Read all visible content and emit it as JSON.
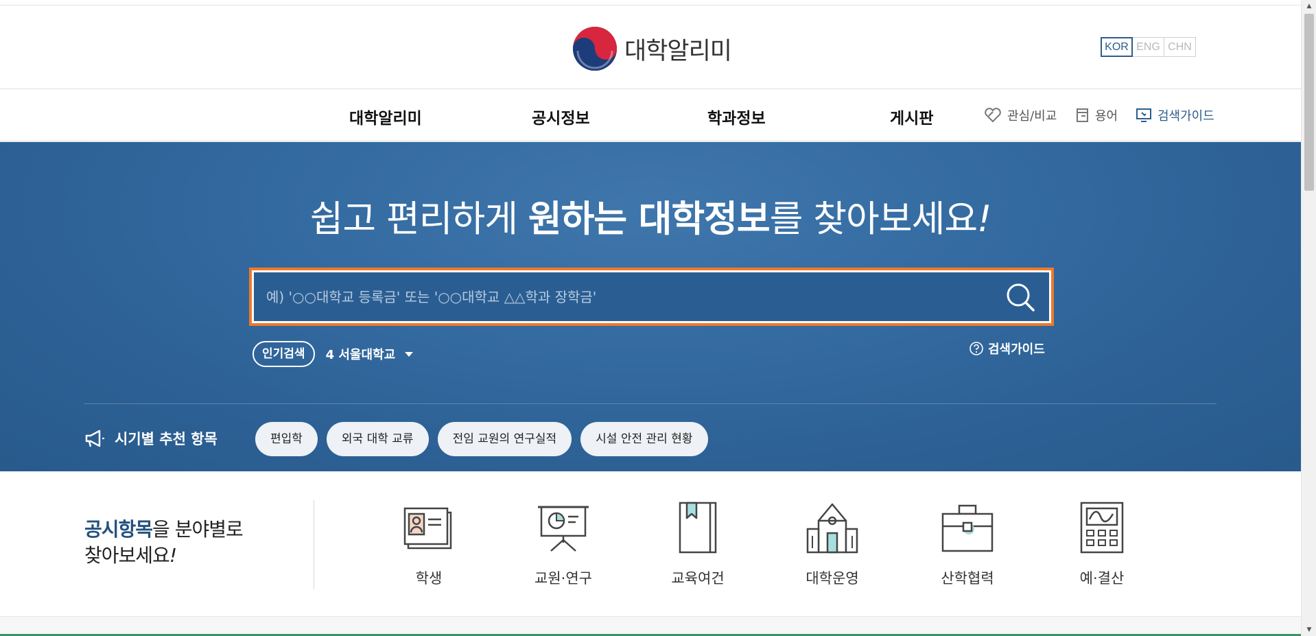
{
  "header": {
    "logo_text": "대학알리미",
    "languages": [
      "KOR",
      "ENG",
      "CHN"
    ],
    "active_language": "KOR"
  },
  "nav": {
    "menu": [
      "대학알리미",
      "공시정보",
      "학과정보",
      "게시판"
    ],
    "utils": {
      "compare": "관심/비교",
      "glossary": "용어",
      "search_guide": "검색가이드"
    }
  },
  "hero": {
    "title_part1": "쉽고 편리하게 ",
    "title_bold": "원하는 대학정보",
    "title_part2": "를 찾아보세요",
    "title_end": "!",
    "search_placeholder": "예) '○○대학교 등록금' 또는 '○○대학교 △△학과 장학금'",
    "popular_badge": "인기검색",
    "popular_item": "4 서울대학교",
    "search_guide": "검색가이드",
    "season_label": "시기별 추천 항목",
    "chips": [
      "편입학",
      "외국 대학 교류",
      "전임 교원의 연구실적",
      "시설 안전 관리 현황"
    ]
  },
  "categories": {
    "heading_bold": "공시항목",
    "heading_rest": "을 분야별로",
    "heading_line2": "찾아보세요",
    "heading_end": "!",
    "items": [
      {
        "label": "학생",
        "icon": "student-card-icon"
      },
      {
        "label": "교원·연구",
        "icon": "presentation-board-icon"
      },
      {
        "label": "교육여건",
        "icon": "bookmark-book-icon"
      },
      {
        "label": "대학운영",
        "icon": "building-icon"
      },
      {
        "label": "산학협력",
        "icon": "briefcase-icon"
      },
      {
        "label": "예·결산",
        "icon": "calculator-icon"
      }
    ]
  },
  "colors": {
    "brand_blue": "#2b5d8d",
    "hero_blue": "#336aa0",
    "search_border": "#f07a28"
  }
}
